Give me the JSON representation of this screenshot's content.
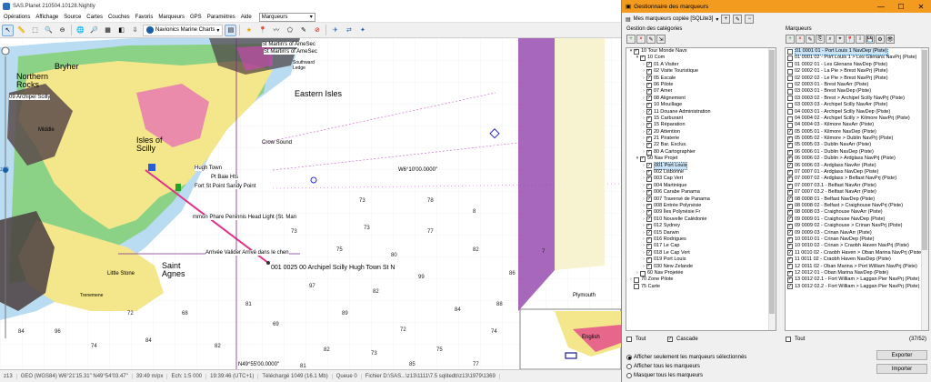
{
  "app": {
    "title": "SAS.Planet 210504.10128.Nightly",
    "menu": [
      "Opérations",
      "Affichage",
      "Source",
      "Cartes",
      "Couches",
      "Favoris",
      "Marqueurs",
      "GPS",
      "Paramètres",
      "Aide"
    ],
    "markers_combo": "Marqueurs",
    "map_source": "Navionics Marine Charts"
  },
  "map": {
    "zoom_level": "z13",
    "labels": {
      "bryher": "Bryher",
      "northern_rocks": "Northern\nRocks",
      "eastern_isles": "Eastern Isles",
      "isles_of_scilly": "Isles of\nScilly",
      "st_agnes": "Saint\nAgnes",
      "crow_sound": "Crow Sound",
      "middle": "Middle",
      "little_stone": "Little Stone",
      "southward": "Southward\nLedge",
      "trenemene": "Trenemene",
      "plymouth": "Plymouth",
      "english": "English",
      "archipel_scilly": "09 Archipel Scilly",
      "marker_label": "001 0025 00 Archipel Scilly Hugh Town St N",
      "lon_label": "W6°10'00.0000\"",
      "lat_label": "N49°55'00.0000\"",
      "chart_labels": [
        "St Martin's of AmeSec",
        "St Martin's of AmeSec",
        "mmon Phare Peninnis Head Light (St. Man",
        "Arrivée Valider Arrivé dans le chen",
        "Hugh Town",
        "Fort St Point Sandy Point",
        "Pt Baie Hts"
      ]
    },
    "depths": [
      "73",
      "77",
      "82",
      "97",
      "82",
      "99",
      "86",
      "84",
      "89",
      "69",
      "72",
      "74",
      "7",
      "82",
      "73",
      "75",
      "82",
      "84",
      "74",
      "8",
      "80",
      "68",
      "72",
      "73",
      "75",
      "78",
      "81",
      "88",
      "84",
      "96",
      "81",
      "85",
      "77",
      "73"
    ]
  },
  "status": {
    "items": [
      "z13",
      "GEO (WGS84) W6°21'15.31\" N49°54'03.47\"",
      "39:49 m/px",
      "Ech: 1:5 000",
      "19:39:46 (UTC+1)",
      "Téléchargé 1049 (16.1 Mb)",
      "Queue 0",
      "Fichier D:\\SAS...\\z13\\1111\\7.5 sqlitedb\\z13\\1979\\1369"
    ]
  },
  "dialog": {
    "title": "Gestionnaire des marqueurs",
    "db_name": "Mes marqueurs copiée [SQLite3]",
    "categories_header": "Gestion des catégories",
    "markers_header": "Marqueurs",
    "categories": [
      {
        "indent": 0,
        "exp": "v",
        "label": "10 Tour Monde Navx",
        "checked": true
      },
      {
        "indent": 1,
        "exp": "v",
        "label": "10 Com",
        "checked": true
      },
      {
        "indent": 2,
        "exp": ">",
        "label": "01 A Visiter",
        "checked": true
      },
      {
        "indent": 2,
        "exp": ">",
        "label": "02 Visite Touristique",
        "checked": true
      },
      {
        "indent": 2,
        "exp": ">",
        "label": "05 Escale",
        "checked": true
      },
      {
        "indent": 2,
        "exp": ">",
        "label": "06 Pilote",
        "checked": true
      },
      {
        "indent": 2,
        "exp": ">",
        "label": "07 Amer",
        "checked": true
      },
      {
        "indent": 2,
        "exp": ">",
        "label": "08 Alignement",
        "checked": true
      },
      {
        "indent": 2,
        "exp": ">",
        "label": "10 Mouillage",
        "checked": true
      },
      {
        "indent": 2,
        "exp": ">",
        "label": "11 Douane Administration",
        "checked": true
      },
      {
        "indent": 2,
        "exp": ">",
        "label": "15 Carburant",
        "checked": true
      },
      {
        "indent": 2,
        "exp": ">",
        "label": "15 Réparation",
        "checked": true
      },
      {
        "indent": 2,
        "exp": ">",
        "label": "20 Attention",
        "checked": true
      },
      {
        "indent": 2,
        "exp": ">",
        "label": "21 Piraterie",
        "checked": true
      },
      {
        "indent": 2,
        "exp": ">",
        "label": "22 Bar. Exclus.",
        "checked": true
      },
      {
        "indent": 2,
        "exp": ">",
        "label": "80 A Cartographier",
        "checked": true
      },
      {
        "indent": 1,
        "exp": "v",
        "label": "50 Nav Projet",
        "checked": true
      },
      {
        "indent": 2,
        "exp": ">",
        "label": "001 Port Louis",
        "checked": true,
        "selected": true
      },
      {
        "indent": 2,
        "exp": ">",
        "label": "002 Lisbonne",
        "checked": true
      },
      {
        "indent": 2,
        "exp": ">",
        "label": "003 Cap Vert",
        "checked": true
      },
      {
        "indent": 2,
        "exp": ">",
        "label": "004 Martinique",
        "checked": true
      },
      {
        "indent": 2,
        "exp": ">",
        "label": "006 Carabe Panama",
        "checked": true
      },
      {
        "indent": 2,
        "exp": ">",
        "label": "007 Traversé de Panama",
        "checked": true
      },
      {
        "indent": 2,
        "exp": ">",
        "label": "008 Entrée Polynésie",
        "checked": true
      },
      {
        "indent": 2,
        "exp": ">",
        "label": "009 Îles Polynésie Fr",
        "checked": true
      },
      {
        "indent": 2,
        "exp": ">",
        "label": "010 Nouvelle Calédonie",
        "checked": true
      },
      {
        "indent": 2,
        "exp": ">",
        "label": "012 Sydney",
        "checked": true
      },
      {
        "indent": 2,
        "exp": ">",
        "label": "015 Darwin",
        "checked": true
      },
      {
        "indent": 2,
        "exp": ">",
        "label": "016 Rodrigues",
        "checked": true
      },
      {
        "indent": 2,
        "exp": ">",
        "label": "017 Le Cap",
        "checked": true
      },
      {
        "indent": 2,
        "exp": ">",
        "label": "018 Le Cap Vert",
        "checked": true
      },
      {
        "indent": 2,
        "exp": ">",
        "label": "019 Port Louis",
        "checked": true
      },
      {
        "indent": 2,
        "exp": ">",
        "label": "030 New Zelande",
        "checked": true
      },
      {
        "indent": 1,
        "exp": ">",
        "label": "60 Nav Projetée",
        "checked": false
      },
      {
        "indent": 0,
        "exp": ">",
        "label": "70 Zone Pilote",
        "checked": false
      },
      {
        "indent": 0,
        "exp": "",
        "label": "75 Carte",
        "checked": false
      }
    ],
    "markers": [
      {
        "label": "01 0001 01 - Port Louis 1 NavDep (Piste)",
        "checked": false,
        "selected": true
      },
      {
        "label": "01 0001 02 - Port Louis 1 > Les Glenans NavPrj (Piste)",
        "checked": false
      },
      {
        "label": "01 0002 01 - Les Glenans NavDep (Piste)",
        "checked": false
      },
      {
        "label": "02 0002 01 - La Pie > Brest NavPrj (Piste)",
        "checked": false
      },
      {
        "label": "02 0002 02 - Le Pie > Brest NavPrj (Piste)",
        "checked": false
      },
      {
        "label": "02 0003 01 - Brest NavArr (Piste)",
        "checked": false
      },
      {
        "label": "03 0003 01 - Brest NavDep (Piste)",
        "checked": false
      },
      {
        "label": "03 0003 02 - Brest > Archipel Scilly NavPrj (Piste)",
        "checked": false
      },
      {
        "label": "03 0003 03 - Archipel Scilly NavArr (Piste)",
        "checked": false
      },
      {
        "label": "04 0003 01 - Archipel Scilly NavDep (Piste)",
        "checked": false
      },
      {
        "label": "04 0004 02 - Archipel Scilly > Kilmore NavPrj (Piste)",
        "checked": false
      },
      {
        "label": "04 0004 03 - Kilmore NavArr (Piste)",
        "checked": false
      },
      {
        "label": "05 0005 01 - Kilmore NavDep (Piste)",
        "checked": true
      },
      {
        "label": "05 0005 02 - Kilmore > Dublin NavPrj (Piste)",
        "checked": true
      },
      {
        "label": "05 0005 03 - Dublin NavArr (Piste)",
        "checked": true
      },
      {
        "label": "06 0006 01 - Dublin NavDep (Piste)",
        "checked": true
      },
      {
        "label": "06 0006 02 - Dublin > Ardglass NavPrj (Piste)",
        "checked": true
      },
      {
        "label": "06 0006 03 - Ardglass NavArr (Piste)",
        "checked": true
      },
      {
        "label": "07 0007 01 - Ardglass NavDep (Piste)",
        "checked": true
      },
      {
        "label": "07 0007 02 - Ardglass > Belfast NavPrj (Piste)",
        "checked": true
      },
      {
        "label": "07 0007 03.1 - Belfast NavArr (Piste)",
        "checked": true
      },
      {
        "label": "07 0007 03.2 - Belfast NavArr (Piste)",
        "checked": true
      },
      {
        "label": "08 0008 01 - Belfast NavDep (Piste)",
        "checked": true
      },
      {
        "label": "08 0008 02 - Belfast > Craighouse NavPrj (Piste)",
        "checked": true
      },
      {
        "label": "08 0008 03 - Craighouse NavArr (Piste)",
        "checked": true
      },
      {
        "label": "09 0009 01 - Craighouse NavDep (Piste)",
        "checked": true
      },
      {
        "label": "09 0009 02 - Craighouse > Crinan NavPrj (Piste)",
        "checked": true
      },
      {
        "label": "09 0009 03 - Crinan NavArr (Piste)",
        "checked": true
      },
      {
        "label": "10 0010 01 - Crinan NavDep (Piste)",
        "checked": true
      },
      {
        "label": "10 0010 02 - Crinan > Craobh Haven NavPrj (Piste)",
        "checked": true
      },
      {
        "label": "11 0010 02 - Craobh Haven > Oban Marina NavPrj (Piste)",
        "checked": true
      },
      {
        "label": "11 0011 02 - Craobh Haven NavDep (Piste)",
        "checked": true
      },
      {
        "label": "12 0011 02 - Oban Marina > Port William NavPrj (Piste)",
        "checked": true
      },
      {
        "label": "12 0012 01 - Oban Marina NavDep (Piste)",
        "checked": true
      },
      {
        "label": "13 0012 02.1 - Fort William > Laggan Pier NavPrj (Piste)",
        "checked": true
      },
      {
        "label": "13 0012 02.2 - Fort William > Laggan Pier NavPrj (Piste)",
        "checked": true
      }
    ],
    "tout_left": "Tout",
    "cascade": "Cascade",
    "tout_right": "Tout",
    "count": "(37/52)",
    "radios": [
      "Afficher seulement les marqueurs sélectionnés",
      "Afficher tous les marqueurs",
      "Masquer tous les marqueurs"
    ],
    "export_btn": "Exporter",
    "import_btn": "Importer",
    "colors": {
      "title": "#f29b1f",
      "border": "#e07000"
    }
  }
}
